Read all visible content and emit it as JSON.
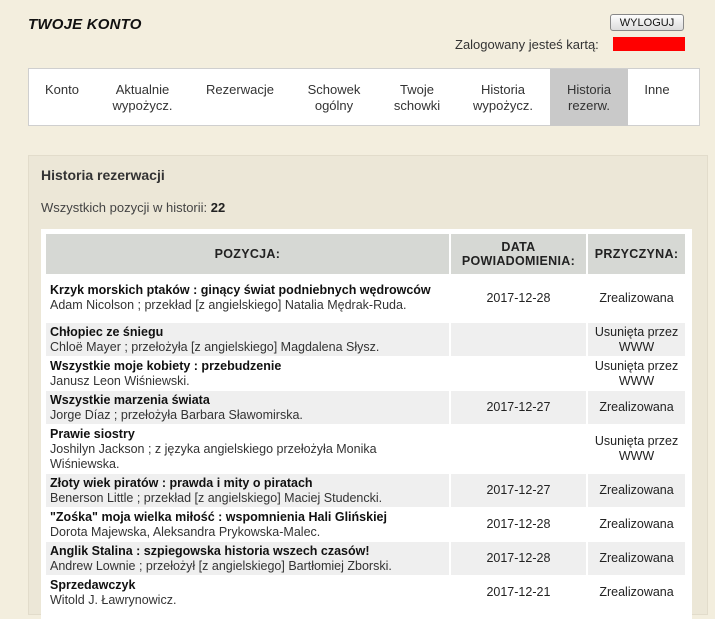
{
  "header": {
    "title": "TWOJE KONTO",
    "logout_label": "WYLOGUJ",
    "logged_in_label": "Zalogowany jesteś kartą:"
  },
  "tabs": [
    {
      "label": "Konto"
    },
    {
      "label": "Aktualnie wypożycz."
    },
    {
      "label": "Rezerwacje"
    },
    {
      "label": "Schowek ogólny"
    },
    {
      "label": "Twoje schowki"
    },
    {
      "label": "Historia wypożycz."
    },
    {
      "label": "Historia rezerw.",
      "active": true
    },
    {
      "label": "Inne"
    }
  ],
  "section": {
    "heading": "Historia rezerwacji",
    "count_label": "Wszystkich pozycji w historii:",
    "count_value": "22"
  },
  "table": {
    "headers": [
      "POZYCJA:",
      "DATA POWIADOMIENIA:",
      "PRZYCZYNA:"
    ],
    "rows": [
      {
        "title": "Krzyk morskich ptaków : ginący świat podniebnych wędrowców",
        "authors": "Adam Nicolson ; przekład [z angielskiego] Natalia Mędrak-Ruda.",
        "date": "2017-12-28",
        "reason": "Zrealizowana"
      },
      {
        "title": "Chłopiec ze śniegu",
        "authors": "Chloë Mayer ; przełożyła [z angielskiego] Magdalena Słysz.",
        "date": "",
        "reason": "Usunięta przez WWW"
      },
      {
        "title": "Wszystkie moje kobiety : przebudzenie",
        "authors": "Janusz Leon Wiśniewski.",
        "date": "",
        "reason": "Usunięta przez WWW"
      },
      {
        "title": "Wszystkie marzenia świata",
        "authors": "Jorge Díaz ; przełożyła Barbara Sławomirska.",
        "date": "2017-12-27",
        "reason": "Zrealizowana"
      },
      {
        "title": "Prawie siostry",
        "authors": "Joshilyn Jackson ; z języka angielskiego przełożyła Monika Wiśniewska.",
        "date": "",
        "reason": "Usunięta przez WWW"
      },
      {
        "title": "Złoty wiek piratów : prawda i mity o piratach",
        "authors": "Benerson Little ; przekład [z angielskiego] Maciej Studencki.",
        "date": "2017-12-27",
        "reason": "Zrealizowana"
      },
      {
        "title": "\"Zośka\" moja wielka miłość : wspomnienia Hali Glińskiej",
        "authors": "Dorota Majewska, Aleksandra Prykowska-Malec.",
        "date": "2017-12-28",
        "reason": "Zrealizowana"
      },
      {
        "title": "Anglik Stalina : szpiegowska historia wszech czasów!",
        "authors": "Andrew Lownie ; przełożył [z angielskiego] Bartłomiej Zborski.",
        "date": "2017-12-28",
        "reason": "Zrealizowana"
      },
      {
        "title": "Sprzedawczyk",
        "authors": "Witold J. Ławrynowicz.",
        "date": "2017-12-21",
        "reason": "Zrealizowana"
      }
    ]
  }
}
